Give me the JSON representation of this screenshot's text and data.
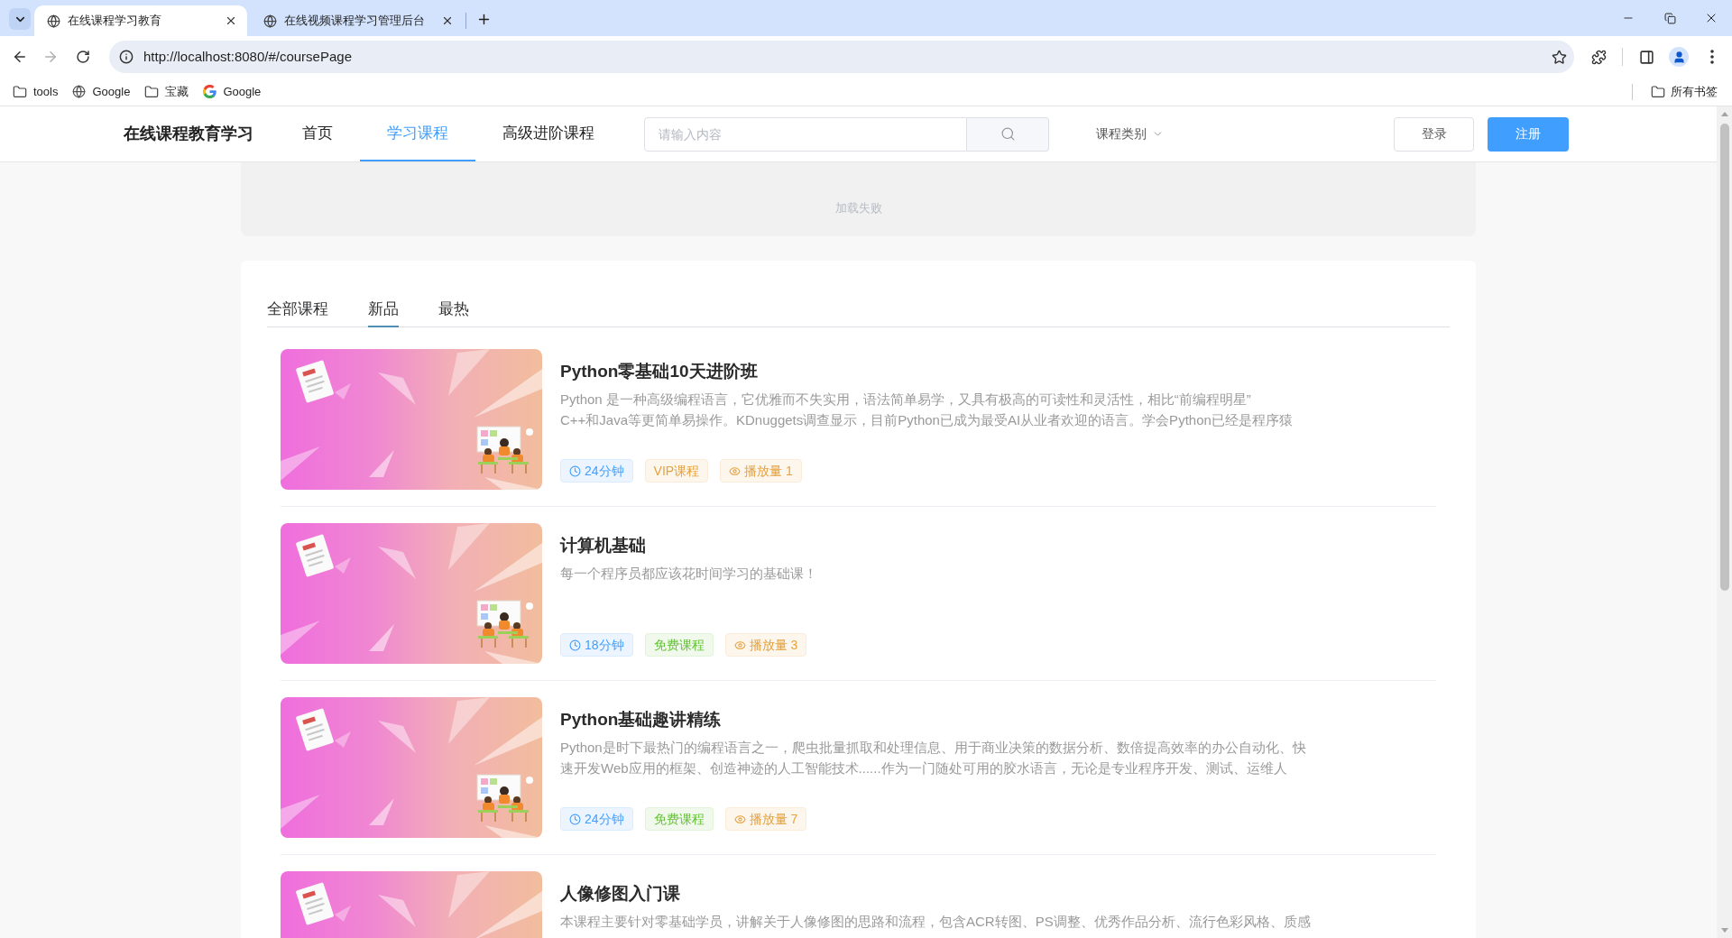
{
  "browser": {
    "tabs": [
      {
        "title": "在线课程学习教育",
        "selected": true
      },
      {
        "title": "在线视频课程学习管理后台",
        "selected": false
      }
    ],
    "url": "http://localhost:8080/#/coursePage",
    "bookmarks": [
      {
        "label": "tools",
        "kind": "folder"
      },
      {
        "label": "Google",
        "kind": "globe"
      },
      {
        "label": "宝藏",
        "kind": "folder"
      },
      {
        "label": "Google",
        "kind": "google"
      }
    ],
    "all_bookmarks": "所有书签"
  },
  "nav": {
    "brand": "在线课程教育学习",
    "items": [
      {
        "label": "首页",
        "selected": false
      },
      {
        "label": "学习课程",
        "selected": true
      },
      {
        "label": "高级进阶课程",
        "selected": false
      }
    ],
    "search": {
      "placeholder": "请输入内容"
    },
    "category": "课程类别",
    "login": "登录",
    "register": "注册"
  },
  "banner": {
    "message": "加载失败"
  },
  "course_tabs": [
    {
      "label": "全部课程",
      "selected": false
    },
    {
      "label": "新品",
      "selected": true
    },
    {
      "label": "最热",
      "selected": false
    }
  ],
  "courses": [
    {
      "title": "Python零基础10天进阶班",
      "description_lines": [
        "Python 是一种高级编程语言，它优雅而不失实用，语法简单易学，又具有极高的可读性和灵活性，相比“前编程明星”",
        "C++和Java等更简单易操作。KDnuggets调查显示，目前Python已成为最受AI从业者欢迎的语言。学会Python已经是程序猿"
      ],
      "duration": "24分钟",
      "access": {
        "label": "VIP课程",
        "kind": "vip"
      },
      "plays": "播放量 1"
    },
    {
      "title": "计算机基础",
      "description_lines": [
        "每一个程序员都应该花时间学习的基础课！"
      ],
      "duration": "18分钟",
      "access": {
        "label": "免费课程",
        "kind": "free"
      },
      "plays": "播放量 3"
    },
    {
      "title": "Python基础趣讲精练",
      "description_lines": [
        "Python是时下最热门的编程语言之一，爬虫批量抓取和处理信息、用于商业决策的数据分析、数倍提高效率的办公自动化、快",
        "速开发Web应用的框架、创造神迹的人工智能技术......作为一门随处可用的胶水语言，无论是专业程序开发、测试、运维人"
      ],
      "duration": "24分钟",
      "access": {
        "label": "免费课程",
        "kind": "free"
      },
      "plays": "播放量 7"
    },
    {
      "title": "人像修图入门课",
      "description_lines": [
        "本课程主要针对零基础学员，讲解关于人像修图的思路和流程，包含ACR转图、PS调整、优秀作品分析、流行色彩风格、质感"
      ]
    }
  ]
}
